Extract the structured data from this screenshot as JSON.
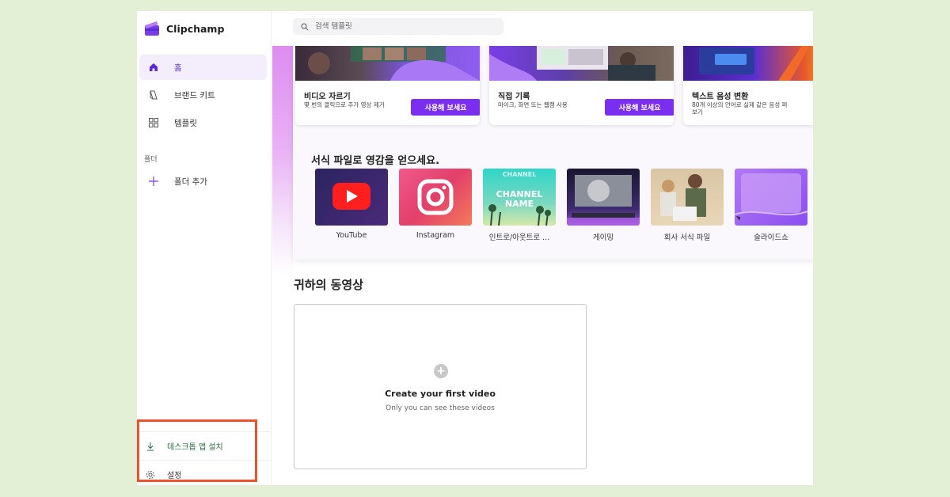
{
  "app": {
    "name": "Clipchamp"
  },
  "search": {
    "placeholder": "검색 템플릿"
  },
  "sidebar": {
    "items": [
      {
        "label": "홈",
        "icon": "home-icon"
      },
      {
        "label": "브랜드 키트",
        "icon": "brand-kit-icon"
      },
      {
        "label": "템플릿",
        "icon": "templates-icon"
      }
    ],
    "folder_section": "폴더",
    "add_folder": "폴더 추가",
    "install_desktop": "데스크톱 앱 설치",
    "settings": "설정"
  },
  "feature_cards": [
    {
      "title": "비디오 자르기",
      "desc": "몇 번의 클릭으로 추가 영상 제거",
      "button": "사용해 보세요"
    },
    {
      "title": "직접 기록",
      "desc": "마이크, 화면 또는 웹캠 사용",
      "button": "사용해 보세요"
    },
    {
      "title": "텍스트 음성 변환",
      "desc": "80개 이상의 언어로 실제 같은 음성 펴보기"
    }
  ],
  "templates": {
    "title": "서식 파일로 영감을 얻으세요.",
    "items": [
      {
        "label": "YouTube"
      },
      {
        "label": "Instagram"
      },
      {
        "label": "인트로/아웃트로 ..."
      },
      {
        "label": "게이밍"
      },
      {
        "label": "회사 서식 파일"
      },
      {
        "label": "슬라이드쇼"
      }
    ]
  },
  "videos": {
    "title": "귀하의 동영상",
    "create_title": "Create your first video",
    "create_subtitle": "Only you can see these videos"
  },
  "colors": {
    "accent": "#7a2ef0",
    "highlight": "#f0512c",
    "background": "#e3f0d5"
  }
}
